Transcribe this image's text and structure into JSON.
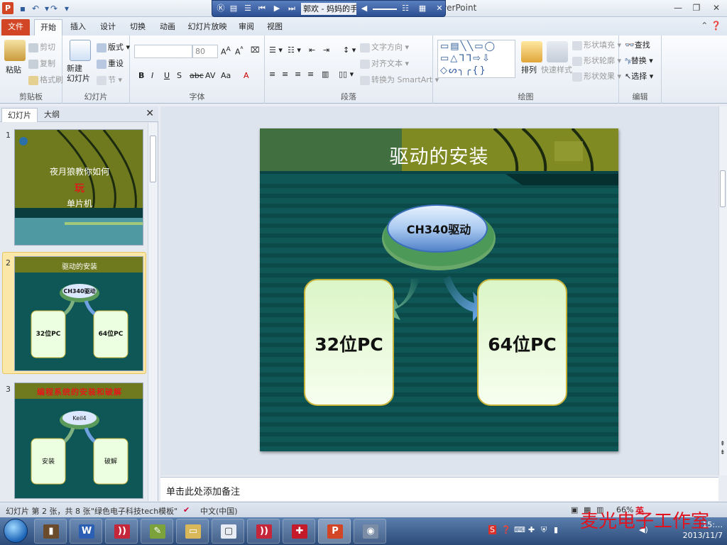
{
  "window": {
    "app_title": "owerPoint",
    "controls": [
      "—",
      "❐",
      "✕"
    ]
  },
  "media_player": {
    "track": "郭欢 - 妈妈的手"
  },
  "tabs": [
    "文件",
    "开始",
    "插入",
    "设计",
    "切换",
    "动画",
    "幻灯片放映",
    "审阅",
    "视图"
  ],
  "ribbon": {
    "clipboard": {
      "label": "剪贴板",
      "paste": "粘贴",
      "cut": "剪切",
      "copy": "复制",
      "format_painter": "格式刷"
    },
    "slides": {
      "label": "幻灯片",
      "new_slide": "新建\n幻灯片",
      "layout": "版式",
      "reset": "重设",
      "section": "节"
    },
    "font": {
      "label": "字体",
      "font_name": "",
      "font_size": "80"
    },
    "paragraph": {
      "label": "段落",
      "text_direction": "文字方向",
      "align_text": "对齐文本",
      "smartart": "转换为 SmartArt"
    },
    "drawing": {
      "label": "绘图",
      "arrange": "排列",
      "quick_styles": "快速样式",
      "shape_fill": "形状填充",
      "shape_outline": "形状轮廓",
      "shape_effects": "形状效果"
    },
    "editing": {
      "label": "编辑",
      "find": "查找",
      "replace": "替换",
      "select": "选择"
    }
  },
  "left_pane": {
    "tabs": [
      "幻灯片",
      "大纲"
    ],
    "slides": [
      {
        "num": "1",
        "line1": "夜月狼教你如何",
        "line2": "玩",
        "line3": "单片机"
      },
      {
        "num": "2",
        "title": "驱动的安装",
        "driver": "CH340驱动",
        "left": "32位PC",
        "right": "64位PC"
      },
      {
        "num": "3",
        "title": "编程系统的安装和破解",
        "center": "Keil4",
        "left": "安装",
        "right": "破解"
      }
    ]
  },
  "slide": {
    "title": "驱动的安装",
    "driver_label": "CH340驱动",
    "left_box": "32位PC",
    "right_box": "64位PC"
  },
  "notes": {
    "placeholder": "单击此处添加备注"
  },
  "statusbar": {
    "slide_info": "幻灯片 第 2 张，共 8 张",
    "theme": "\"绿色电子科技tech模板\"",
    "language": "中文(中国)",
    "zoom": "66%"
  },
  "taskbar": {
    "time": "15:…",
    "date": "2013/11/7",
    "watermark": "麦光电子工作室",
    "ime": "英"
  },
  "colors": {
    "file_tab": "#d24625",
    "slide_bg": "#0f5656",
    "title_band": "#7f8a22",
    "box_fill": "#ecffe0",
    "box_border": "#c9b43a"
  }
}
